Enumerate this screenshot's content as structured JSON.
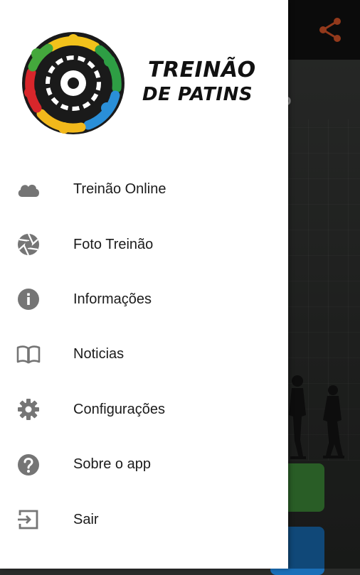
{
  "colors": {
    "icon_gray": "#757575",
    "share_orange": "#e2582a",
    "toolbar_bg": "#111111",
    "green_action": "#3f8f3b",
    "blue_action": "#1a6fb8"
  },
  "background_app": {
    "partial_text": "o",
    "share_icon": "share-icon"
  },
  "logo": {
    "line1": "TREINÃO",
    "line2": "DE PATINS"
  },
  "menu": {
    "items": [
      {
        "label": "Treinão Online",
        "icon": "cloud-icon"
      },
      {
        "label": "Foto Treinão",
        "icon": "camera-aperture-icon"
      },
      {
        "label": "Informações",
        "icon": "info-icon"
      },
      {
        "label": "Noticias",
        "icon": "book-icon"
      },
      {
        "label": "Configurações",
        "icon": "gear-icon"
      },
      {
        "label": "Sobre o app",
        "icon": "help-icon"
      },
      {
        "label": "Sair",
        "icon": "exit-icon"
      }
    ]
  }
}
